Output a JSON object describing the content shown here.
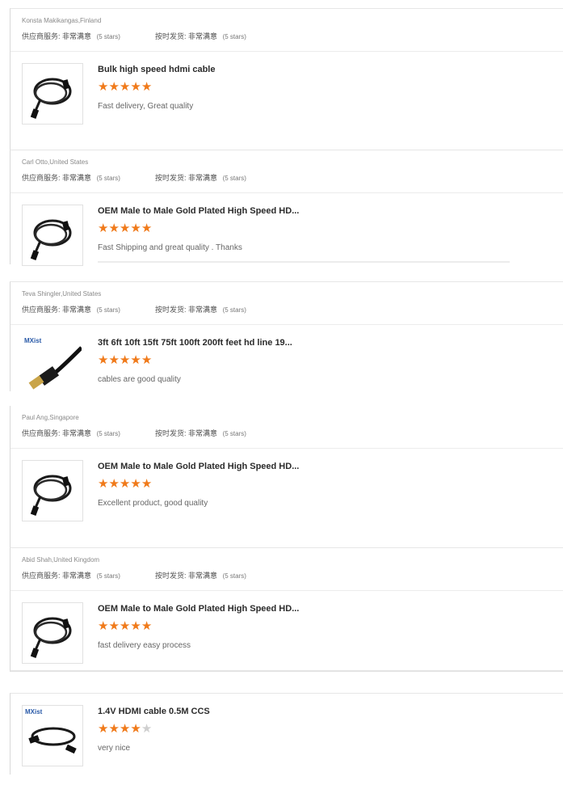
{
  "labels": {
    "supplier_service": "供应商服务:",
    "on_time_shipment": "按时发货:",
    "very_satisfied": "非常满意",
    "five_stars": "(5 stars)"
  },
  "colors": {
    "star_on": "#f07a1a",
    "star_off": "#cfcfcf",
    "brand": "#2a5aa8"
  },
  "reviews": [
    {
      "reviewer": "Konsta Makikangas,Finland",
      "product_title": "Bulk high speed hdmi cable",
      "rating": 5,
      "comment": "Fast delivery, Great quality",
      "image": "hdmi-cable-coil"
    },
    {
      "reviewer": "Carl Otto,United States",
      "product_title": "OEM Male to Male Gold Plated High Speed HD...",
      "rating": 5,
      "comment": "Fast Shipping and great quality . Thanks",
      "image": "hdmi-cable-coil"
    },
    {
      "reviewer": "Teva Shingler,United States",
      "product_title": "3ft 6ft 10ft 15ft 75ft 100ft 200ft feet hd line 19...",
      "rating": 5,
      "comment": "cables are good quality",
      "image": "hdmi-connector-closeup",
      "brand": "MXist"
    },
    {
      "reviewer": "Paul Ang,Singapore",
      "product_title": "OEM Male to Male Gold Plated High Speed HD...",
      "rating": 5,
      "comment": "Excellent product, good quality",
      "image": "hdmi-cable-coil"
    },
    {
      "reviewer": "Abid Shah,United Kingdom",
      "product_title": "OEM Male to Male Gold Plated High Speed HD...",
      "rating": 5,
      "comment": "fast delivery easy process",
      "image": "hdmi-cable-coil"
    },
    {
      "product_title": "1.4V HDMI cable 0.5M CCS",
      "rating": 4,
      "comment": "very nice",
      "image": "hdmi-cable-short",
      "brand": "MXist"
    }
  ]
}
